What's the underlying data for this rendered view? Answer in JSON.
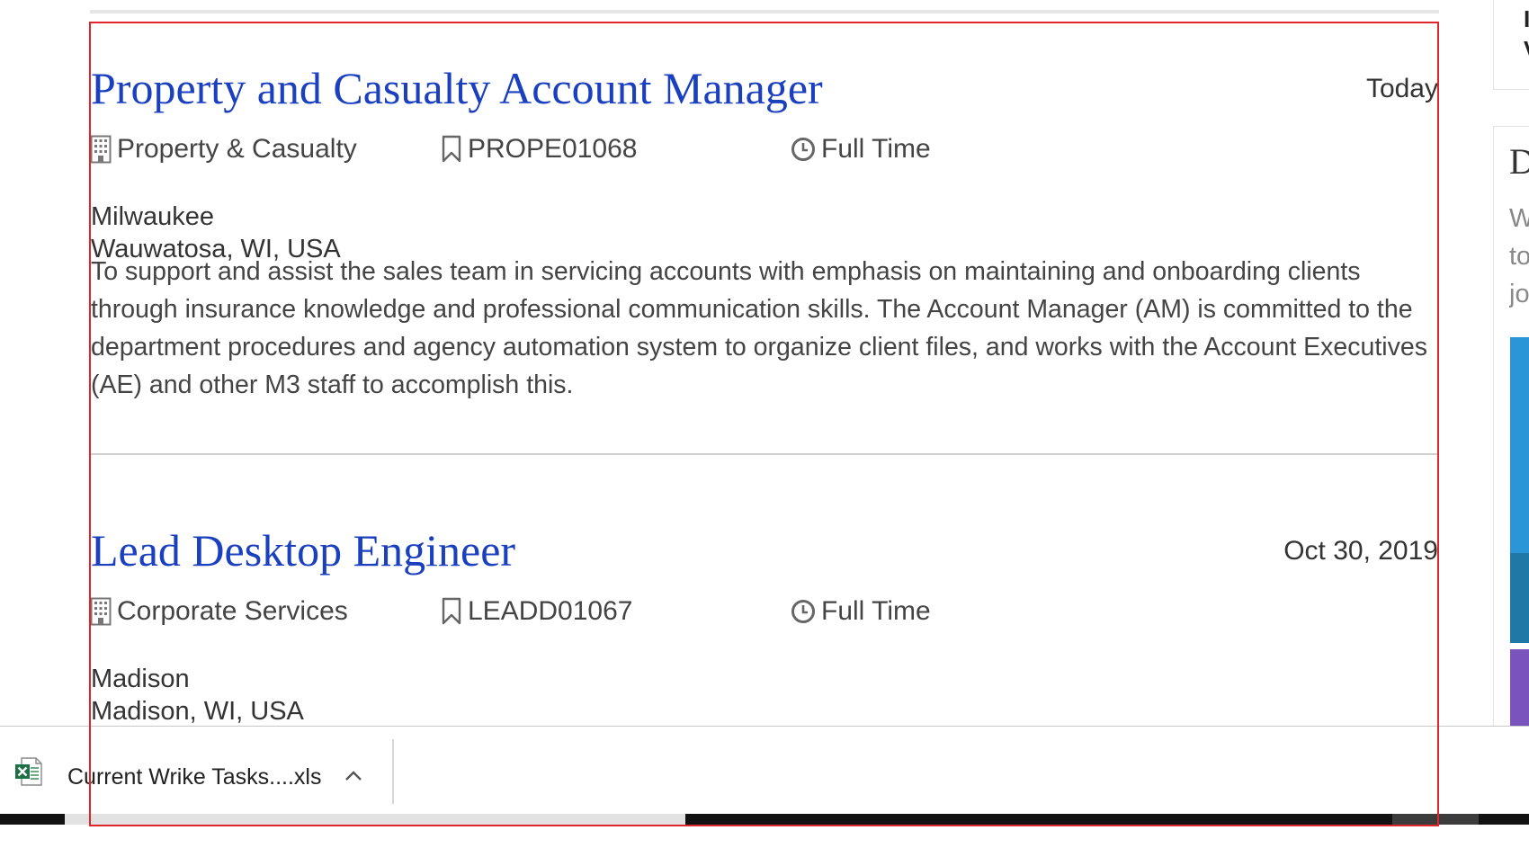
{
  "jobs": [
    {
      "title": "Property and Casualty Account Manager",
      "date": "Today",
      "department": "Property & Casualty",
      "requisition_id": "PROPE01068",
      "job_type": "Full Time",
      "location_name": "Milwaukee",
      "location_address": "Wauwatosa, WI, USA",
      "description": "To support and assist the sales team in servicing accounts with emphasis on maintaining and onboarding clients through insurance knowledge and professional communication skills. The Account Manager (AM) is committed to the department procedures and agency automation system to organize client files, and works with the Account Executives (AE) and other M3 staff to accomplish this."
    },
    {
      "title": "Lead Desktop Engineer",
      "date": "Oct 30, 2019",
      "department": "Corporate Services",
      "requisition_id": "LEADD01067",
      "job_type": "Full Time",
      "location_name": "Madison",
      "location_address": "Madison, WI, USA"
    }
  ],
  "sidebar": {
    "card1_text": "I\nV",
    "heading": "D",
    "text_lines": [
      "W",
      "to",
      "jo"
    ]
  },
  "download_bar": {
    "file_name": "Current Wrike Tasks....xls",
    "file_icon": "excel-file-icon",
    "menu_icon": "chevron-up-icon"
  },
  "colors": {
    "title_link": "#1a3fbf",
    "highlight_box": "#e0262c",
    "sidebar_blue": "#2a96d8",
    "sidebar_purple": "#7b53bd"
  }
}
